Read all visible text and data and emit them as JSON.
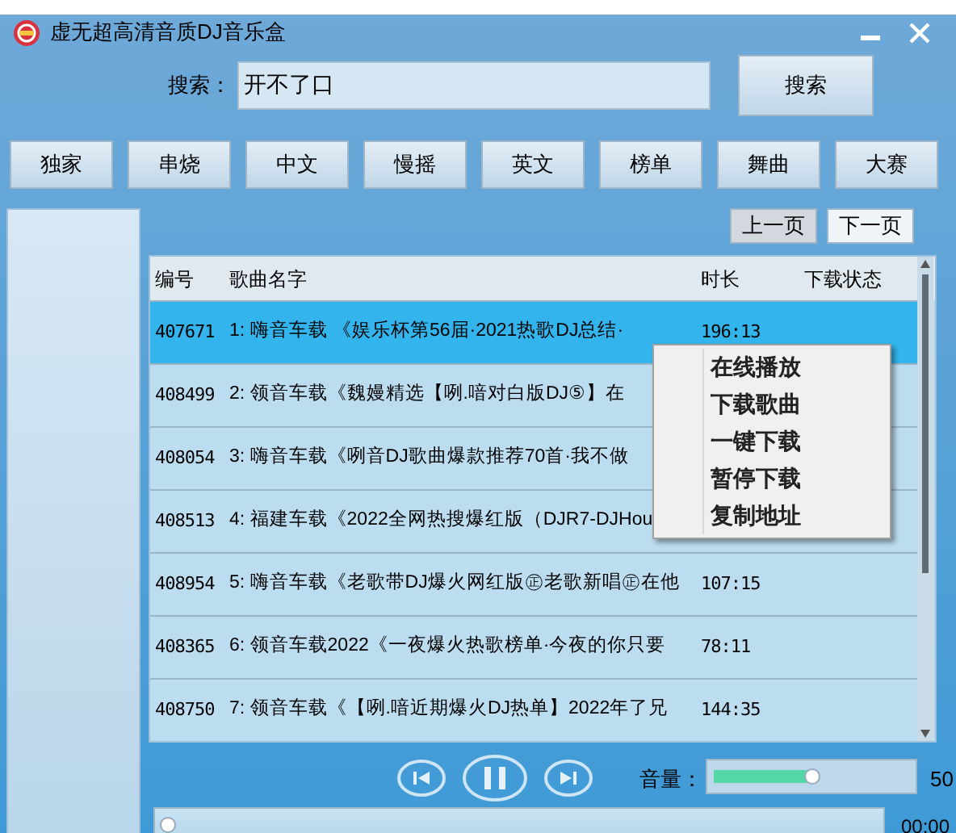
{
  "window": {
    "title": "虚无超高清音质DJ音乐盒"
  },
  "search": {
    "label": "搜索：",
    "value": "开不了口",
    "button": "搜索"
  },
  "categories": [
    "独家",
    "串烧",
    "中文",
    "慢摇",
    "英文",
    "榜单",
    "舞曲",
    "大赛"
  ],
  "pager": [
    "上一页",
    "下一页"
  ],
  "table": {
    "columns": [
      "编号",
      "歌曲名字",
      "时长",
      "下载状态"
    ],
    "rows": [
      {
        "id": "407671",
        "name": "1: 嗨音车载 《娱乐杯第56届·2021热歌DJ总结·",
        "duration": "196:13",
        "selected": true
      },
      {
        "id": "408499",
        "name": "2: 领音车载《魏嫚精选【咧.喑对白版DJ⑤】在",
        "selected": false
      },
      {
        "id": "408054",
        "name": "3: 嗨音车载《咧音DJ歌曲爆款推荐70首·我不做",
        "selected": false
      },
      {
        "id": "408513",
        "name": "4: 福建车载《2022全网热搜爆红版（DJR7-DJHou",
        "selected": false
      },
      {
        "id": "408954",
        "name": "5: 嗨音车载《老歌带DJ爆火网红版㊣老歌新唱㊣在他",
        "duration": "107:15",
        "selected": false
      },
      {
        "id": "408365",
        "name": "6: 领音车载2022《一夜爆火热歌榜单·今夜的你只要",
        "duration": "78:11",
        "selected": false
      },
      {
        "id": "408750",
        "name": "7: 领音车载《【咧.喑近期爆火DJ热单】2022年了兄",
        "duration": "144:35",
        "selected": false
      }
    ]
  },
  "context_menu": [
    "在线播放",
    "下载歌曲",
    "一键下载",
    "暂停下载",
    "复制地址"
  ],
  "player": {
    "volume_label": "音量：",
    "volume": {
      "level": 0.5
    },
    "volume_value": "50",
    "progress": {
      "level": 0
    },
    "time": "00:00"
  }
}
